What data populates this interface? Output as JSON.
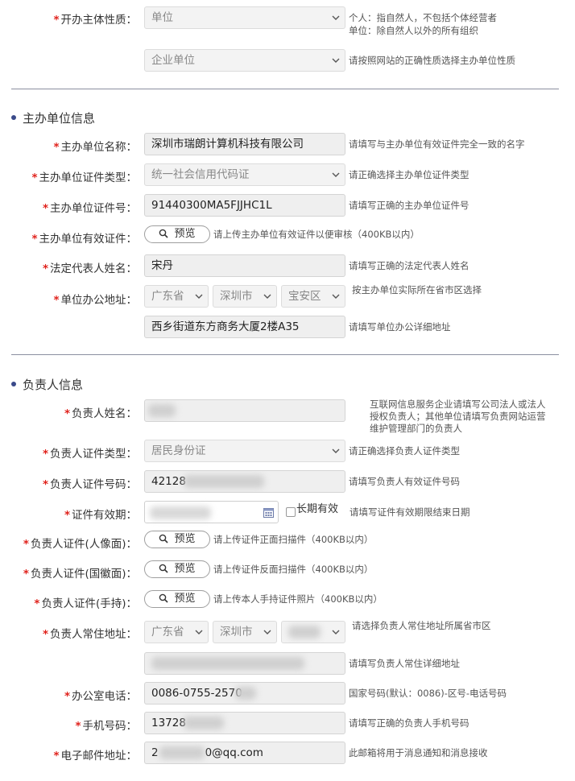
{
  "org_type": {
    "label": "开办主体性质：",
    "select1": "单位",
    "select2": "企业单位",
    "hint1_line1": "个人：指自然人，不包括个体经营者",
    "hint1_line2": "单位：除自然人以外的所有组织",
    "hint2": "请按照网站的正确性质选择主办单位性质"
  },
  "sponsor": {
    "section_title": "主办单位信息",
    "name_label": "主办单位名称：",
    "name_value": "深圳市瑞朗计算机科技有限公司",
    "name_hint": "请填写与主办单位有效证件完全一致的名字",
    "cert_type_label": "主办单位证件类型：",
    "cert_type_value": "统一社会信用代码证",
    "cert_type_hint": "请正确选择主办单位证件类型",
    "cert_no_label": "主办单位证件号：",
    "cert_no_value": "91440300MA5FJJHC1L",
    "cert_no_hint": "请填写正确的主办单位证件号",
    "cert_file_label": "主办单位有效证件：",
    "cert_file_button": "预览",
    "cert_file_hint": "请上传主办单位有效证件以便审核（400KB以内）",
    "legal_label": "法定代表人姓名：",
    "legal_value": "宋丹",
    "legal_hint": "请填写正确的法定代表人姓名",
    "addr_label": "单位办公地址：",
    "province": "广东省",
    "city": "深圳市",
    "district": "宝安区",
    "addr_region_hint": "按主办单位实际所在省市区选择",
    "addr_detail": "西乡街道东方商务大厦2楼A35",
    "addr_detail_hint": "请填写单位办公详细地址"
  },
  "owner": {
    "section_title": "负责人信息",
    "name_label": "负责人姓名：",
    "name_hint_line1": "互联网信息服务企业请填写公司法人或法人",
    "name_hint_line2": "授权负责人；其他单位请填写负责网站运营",
    "name_hint_line3": "维护管理部门的负责人",
    "id_type_label": "负责人证件类型：",
    "id_type_value": "居民身份证",
    "id_type_hint": "请正确选择负责人证件类型",
    "id_no_label": "负责人证件号码：",
    "id_no_value": "42128",
    "id_no_hint": "请填写负责人有效证件号码",
    "validity_label": "证件有效期：",
    "long_term_label": "长期有效",
    "validity_hint": "请填写证件有效期限结束日期",
    "photo_front_label": "负责人证件(人像面)：",
    "photo_front_hint": "请上传证件正面扫描件（400KB以内）",
    "photo_back_label": "负责人证件(国徽面)：",
    "photo_back_hint": "请上传证件反面扫描件（400KB以内）",
    "photo_hand_label": "负责人证件(手持)：",
    "photo_hand_hint": "请上传本人手持证件照片（400KB以内）",
    "preview_button": "预览",
    "addr_label": "负责人常住地址：",
    "province": "广东省",
    "city": "深圳市",
    "addr_region_hint": "请选择负责人常住地址所属省市区",
    "addr_detail_hint": "请填写负责人常住详细地址",
    "office_phone_label": "办公室电话：",
    "office_phone_value": "0086-0755-2570",
    "office_phone_hint": "国家号码(默认：0086)-区号-电话号码",
    "mobile_label": "手机号码：",
    "mobile_value": "13728",
    "mobile_hint": "请填写正确的负责人手机号码",
    "email_label": "电子邮件地址：",
    "email_prefix": "2",
    "email_suffix": "0@qq.com",
    "email_hint": "此邮箱将用于消息通知和消息接收"
  },
  "colors": {
    "required_star": "#e0211b",
    "section_dot": "#3a4a8a",
    "divider": "#8b8fa0"
  }
}
